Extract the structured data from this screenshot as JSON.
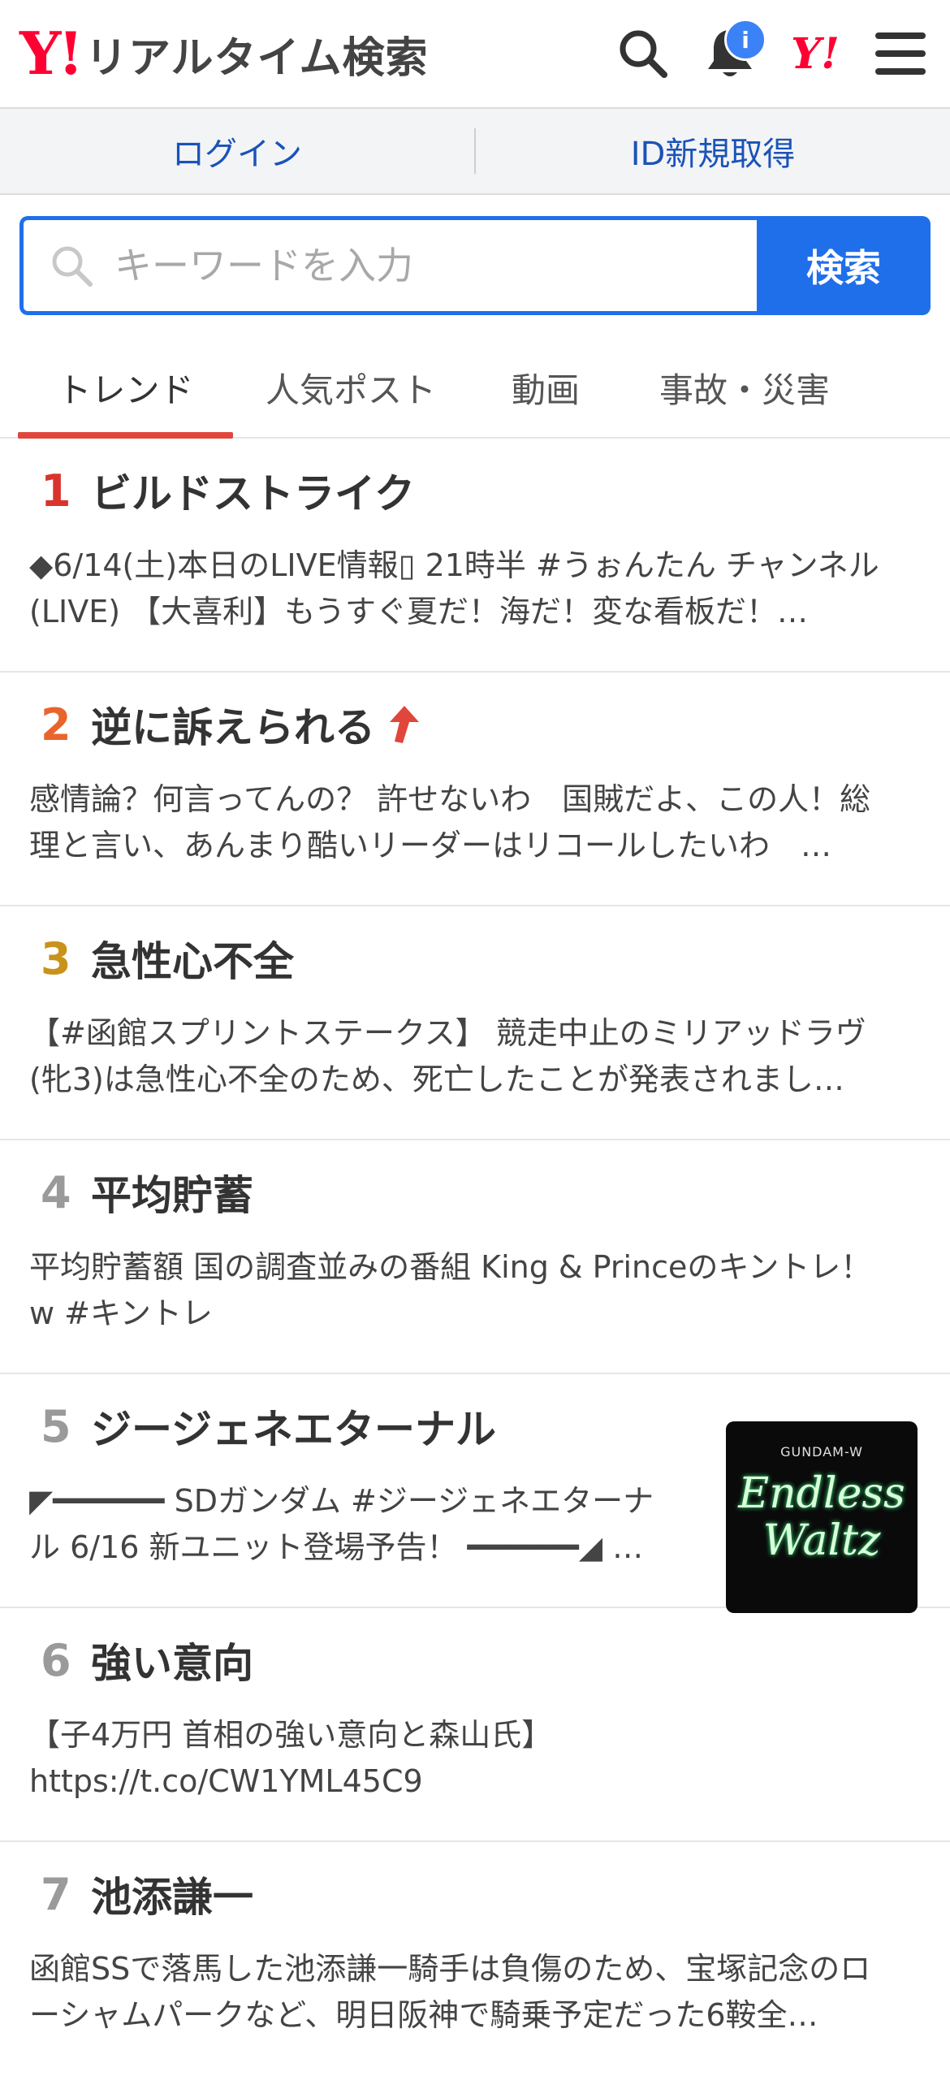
{
  "header": {
    "logo_mark": "Y!",
    "title": "リアルタイム検索",
    "notification_badge": "i",
    "yahoo_mark": "Y!"
  },
  "auth": {
    "login": "ログイン",
    "register": "ID新規取得"
  },
  "search": {
    "placeholder": "キーワードを入力",
    "button": "検索"
  },
  "tabs": [
    {
      "label": "トレンド",
      "active": true
    },
    {
      "label": "人気ポスト",
      "active": false
    },
    {
      "label": "動画",
      "active": false
    },
    {
      "label": "事故・災害",
      "active": false
    }
  ],
  "trends": [
    {
      "rank": "1",
      "title": "ビルドストライク",
      "desc": "◆6/14(土)本日のLIVE情報▯ 21時半 #うぉんたん チャンネル(LIVE) 【大喜利】もうすぐ夏だ！海だ！変な看板だ！…",
      "rank_color": "#d9342b"
    },
    {
      "rank": "2",
      "title": "逆に訴えられる",
      "desc": "感情論？何言ってんの？ 許せないわ　国賊だよ、この人！総理と言い、あんまり酷いリーダーはリコールしたいわ　…",
      "rank_color": "#e9642c",
      "rising": true
    },
    {
      "rank": "3",
      "title": "急性心不全",
      "desc": "【#函館スプリントステークス】 競走中止のミリアッドラヴ(牝3)は急性心不全のため、死亡したことが発表されまし…",
      "rank_color": "#c9921a"
    },
    {
      "rank": "4",
      "title": "平均貯蓄",
      "desc": "平均貯蓄額 国の調査並みの番組 King & Princeのキントレ！w #キントレ",
      "rank_color": "#9a9a9a"
    },
    {
      "rank": "5",
      "title": "ジージェネエターナル",
      "desc": "◤━━━━━━ SDガンダム #ジージェネエターナル 6/16 新ユニット登場予告！ ━━━━━━◢ …",
      "rank_color": "#9a9a9a",
      "thumb": {
        "subtitle": "GUNDAM-W",
        "text": "Endless Waltz"
      }
    },
    {
      "rank": "6",
      "title": "強い意向",
      "desc": "【子4万円 首相の強い意向と森山氏】 https://t.co/CW1YML45C9",
      "rank_color": "#9a9a9a"
    },
    {
      "rank": "7",
      "title": "池添謙一",
      "desc": "函館SSで落馬した池添謙一騎手は負傷のため、宝塚記念のローシャムパークなど、明日阪神で騎乗予定だった6鞍全…",
      "rank_color": "#9a9a9a"
    }
  ]
}
